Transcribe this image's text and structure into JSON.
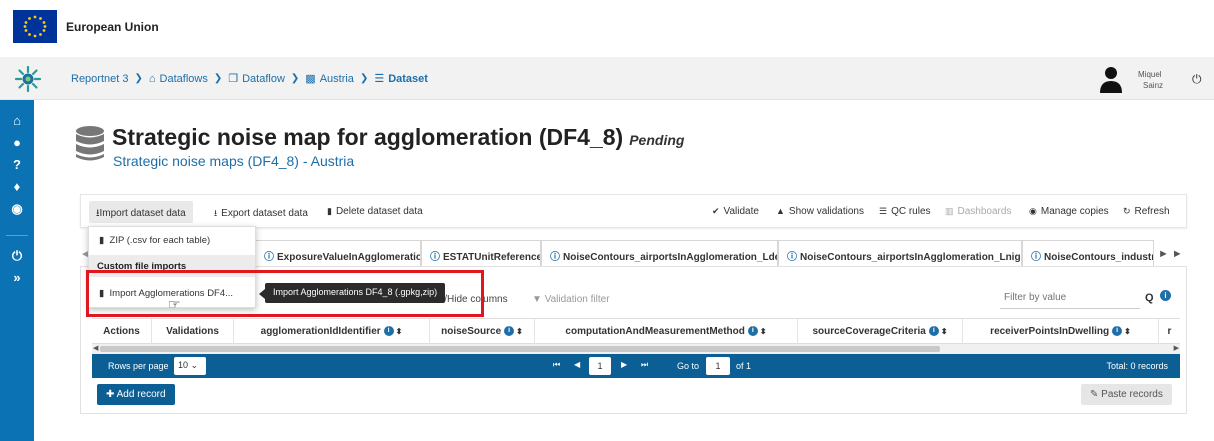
{
  "eu_bar": {
    "label": "European Union"
  },
  "breadcrumb": {
    "items": [
      "Reportnet 3",
      "Dataflows",
      "Dataflow",
      "Austria",
      "Dataset"
    ]
  },
  "user": {
    "first_name": "Miquel",
    "last_name": "Sainz"
  },
  "dataset": {
    "title": "Strategic noise map for agglomeration (DF4_8)",
    "status": "Pending",
    "subtitle": "Strategic noise maps (DF4_8) - Austria"
  },
  "toolbar": {
    "import_label": "Import dataset data",
    "export_label": "Export dataset data",
    "delete_label": "Delete dataset data",
    "validate_label": "Validate",
    "show_validations_label": "Show validations",
    "qc_rules_label": "QC rules",
    "dashboards_label": "Dashboards",
    "manage_copies_label": "Manage copies",
    "refresh_label": "Refresh"
  },
  "dropdown": {
    "zip_label": "ZIP (.csv for each table)",
    "custom_header": "Custom file imports",
    "import_agg_label": "Import Agglomerations DF4..."
  },
  "tooltip": {
    "text": "Import Agglomerations DF4_8 (.gpkg,zip)"
  },
  "tabs": [
    "ExposureValueInAgglomeration",
    "ESTATUnitReference",
    "NoiseContours_airportsInAgglomeration_Lden",
    "NoiseContours_airportsInAgglomeration_Lnight",
    "NoiseContours_industry"
  ],
  "table_tools": {
    "show_hide_label": "w/Hide columns",
    "validation_filter_label": "Validation filter",
    "filter_placeholder": "Filter by value"
  },
  "columns": [
    "Actions",
    "Validations",
    "agglomerationIdIdentifier",
    "noiseSource",
    "computationAndMeasurementMethod",
    "sourceCoverageCriteria",
    "receiverPointsInDwelling",
    "r"
  ],
  "pager": {
    "rows_per_page_label": "Rows per page",
    "rows_per_page_value": "10",
    "current_page": "1",
    "goto_label": "Go to",
    "goto_value": "1",
    "of_label": "of 1",
    "total_label": "Total: 0 records"
  },
  "actions": {
    "add_record_label": "Add record",
    "paste_records_label": "Paste records"
  },
  "colors": {
    "sidebar": "#0b73b4",
    "pager": "#0b5f95",
    "link": "#1e6fa8",
    "highlight": "#e0171f"
  }
}
